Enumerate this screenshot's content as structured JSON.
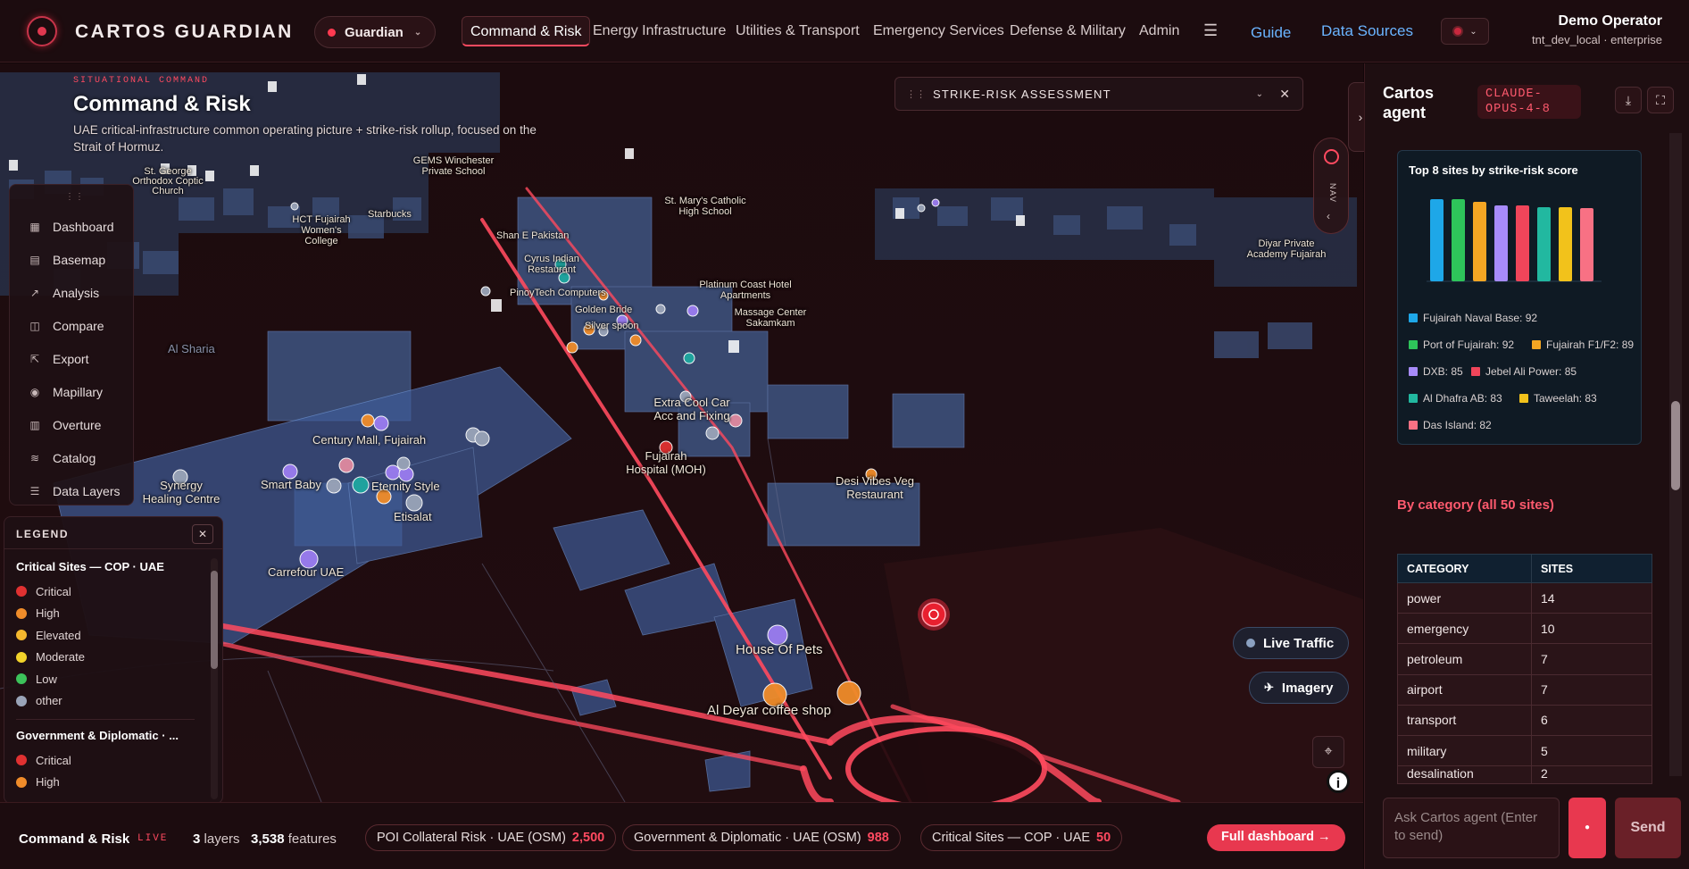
{
  "brand": "CARTOS GUARDIAN",
  "workspace_selector": "Guardian",
  "nav": {
    "tabs": [
      "Command & Risk",
      "Energy Infrastructure",
      "Utilities & Transport",
      "Emergency Services",
      "Defense & Military",
      "Admin"
    ],
    "active_tab": "Command & Risk",
    "guide": "Guide",
    "data_sources": "Data Sources"
  },
  "user": {
    "name": "Demo Operator",
    "tenant": "tnt_dev_local · enterprise"
  },
  "page": {
    "eyebrow": "SITUATIONAL COMMAND",
    "title": "Command & Risk",
    "subtitle": "UAE critical-infrastructure common operating picture + strike-risk rollup, focused on the Strait of Hormuz."
  },
  "sidebar": {
    "items": [
      {
        "label": "Dashboard",
        "icon": "dashboard-icon"
      },
      {
        "label": "Basemap",
        "icon": "map-icon"
      },
      {
        "label": "Analysis",
        "icon": "analysis-icon"
      },
      {
        "label": "Compare",
        "icon": "compare-icon"
      },
      {
        "label": "Export",
        "icon": "export-icon"
      },
      {
        "label": "Mapillary",
        "icon": "camera-icon"
      },
      {
        "label": "Overture",
        "icon": "grid-icon"
      },
      {
        "label": "Catalog",
        "icon": "layers-icon"
      },
      {
        "label": "Data Layers",
        "icon": "stack-icon"
      }
    ]
  },
  "legend": {
    "title": "LEGEND",
    "groups": [
      {
        "name": "Critical Sites — COP · UAE",
        "rows": [
          {
            "label": "Critical",
            "color": "#e03131"
          },
          {
            "label": "High",
            "color": "#f08c2a"
          },
          {
            "label": "Elevated",
            "color": "#f5b82e"
          },
          {
            "label": "Moderate",
            "color": "#f2d32a"
          },
          {
            "label": "Low",
            "color": "#3cc25a"
          },
          {
            "label": "other",
            "color": "#9aa4b8"
          }
        ]
      },
      {
        "name": "Government & Diplomatic · ...",
        "rows": [
          {
            "label": "Critical",
            "color": "#e03131"
          },
          {
            "label": "High",
            "color": "#f08c2a"
          }
        ]
      }
    ]
  },
  "strike_panel": {
    "title": "STRIKE-RISK ASSESSMENT"
  },
  "nav_control": {
    "label": "NAV"
  },
  "map_controls": {
    "live_traffic": "Live Traffic",
    "imagery": "Imagery"
  },
  "map_labels": {
    "century_mall": "Century Mall, Fujairah",
    "smart_baby": "Smart Baby",
    "eternity_style": "Eternity Style",
    "etisalat": "Etisalat",
    "synergy": "Synergy Healing Centre",
    "carrefour": "Carrefour UAE",
    "al_sharia": "Al Sharia",
    "hct": "HCT Fujairah Women's College",
    "starbucks": "Starbucks",
    "gems": "GEMS Winchester Private School",
    "st_george": "St. George Orthodox Coptic Church",
    "st_mary": "St. Mary's Catholic High School",
    "shan_e_pakistan": "Shan E Pakistan",
    "cyrus": "Cyrus Indian Restaurant",
    "pinoytech": "PinoyTech Computers",
    "golden_bride": "Golden Bride",
    "silver_spoon": "Silver spoon",
    "platinum_coast": "Platinum Coast Hotel Apartments",
    "massage": "Massage Center Sakamkam",
    "extra_cool": "Extra Cool Car Acc and Fixing",
    "fujairah_hospital": "Fujairah Hospital (MOH)",
    "desi_vibes": "Desi Vibes Veg Restaurant",
    "house_of_pets": "House Of Pets",
    "al_deyar": "Al Deyar coffee shop",
    "diyar": "Diyar Private Academy Fujairah"
  },
  "bottom_bar": {
    "title": "Command & Risk",
    "live": "LIVE",
    "layers_count": "3",
    "layers_label": "layers",
    "features_count": "3,538",
    "features_label": "features",
    "chips": [
      {
        "label": "POI Collateral Risk · UAE (OSM)",
        "count": "2,500"
      },
      {
        "label": "Government & Diplomatic · UAE (OSM)",
        "count": "988"
      },
      {
        "label": "Critical Sites — COP · UAE",
        "count": "50"
      }
    ],
    "full_dashboard": "Full dashboard →"
  },
  "agent": {
    "title": "Cartos agent",
    "model": "CLAUDE-OPUS-4-8",
    "category_heading": "By category (all 50 sites)",
    "table_headers": [
      "CATEGORY",
      "SITES"
    ],
    "table_rows": [
      [
        "power",
        "14"
      ],
      [
        "emergency",
        "10"
      ],
      [
        "petroleum",
        "7"
      ],
      [
        "airport",
        "7"
      ],
      [
        "transport",
        "6"
      ],
      [
        "military",
        "5"
      ],
      [
        "desalination",
        "2"
      ]
    ],
    "input_placeholder": "Ask Cartos agent (Enter to send)",
    "send": "Send"
  },
  "chart_data": {
    "type": "bar",
    "title": "Top 8 sites by strike-risk score",
    "categories": [
      "Fujairah Naval Base",
      "Port of Fujairah",
      "Fujairah F1/F2",
      "DXB",
      "Jebel Ali Power",
      "Al Dhafra AB",
      "Taweelah",
      "Das Island"
    ],
    "values": [
      92,
      92,
      89,
      85,
      85,
      83,
      83,
      82
    ],
    "colors": [
      "#1ea7e8",
      "#2ec45a",
      "#f5a623",
      "#a78bfa",
      "#f0455a",
      "#22b8a0",
      "#f2c21b",
      "#f87184"
    ],
    "legend": [
      "Fujairah Naval Base: 92",
      "Port of Fujairah: 92",
      "Fujairah F1/F2: 89",
      "DXB: 85",
      "Jebel Ali Power: 85",
      "Al Dhafra AB: 83",
      "Taweelah: 83",
      "Das Island: 82"
    ],
    "xlabel": "",
    "ylabel": "",
    "ylim": [
      0,
      100
    ],
    "grid": false
  }
}
